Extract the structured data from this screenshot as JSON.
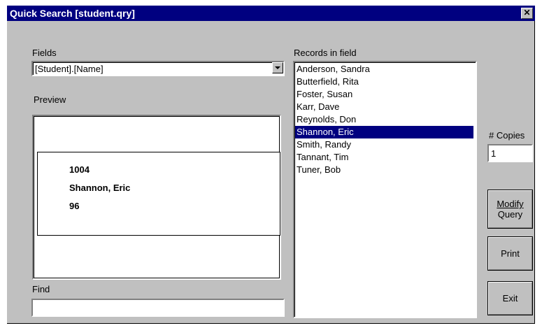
{
  "window": {
    "title": "Quick Search [student.qry]",
    "close_glyph": "✕"
  },
  "fields": {
    "label": "Fields",
    "selected": "[Student].[Name]"
  },
  "preview": {
    "label": "Preview",
    "lines": [
      "1004",
      "Shannon, Eric",
      "96"
    ]
  },
  "find": {
    "label": "Find",
    "value": ""
  },
  "records": {
    "label": "Records in field",
    "items": [
      "Anderson, Sandra",
      "Butterfield, Rita",
      "Foster, Susan",
      "Karr, Dave",
      "Reynolds, Don",
      "Shannon, Eric",
      "Smith, Randy",
      "Tannant, Tim",
      "Tuner, Bob"
    ],
    "selected_index": 5
  },
  "copies": {
    "label": "# Copies",
    "value": "1"
  },
  "buttons": {
    "modify_line1": "Modify",
    "modify_line2": "Query",
    "print": "Print",
    "exit": "Exit"
  },
  "colors": {
    "titlebar": "#000080",
    "selection": "#000080",
    "face": "#c0c0c0"
  }
}
